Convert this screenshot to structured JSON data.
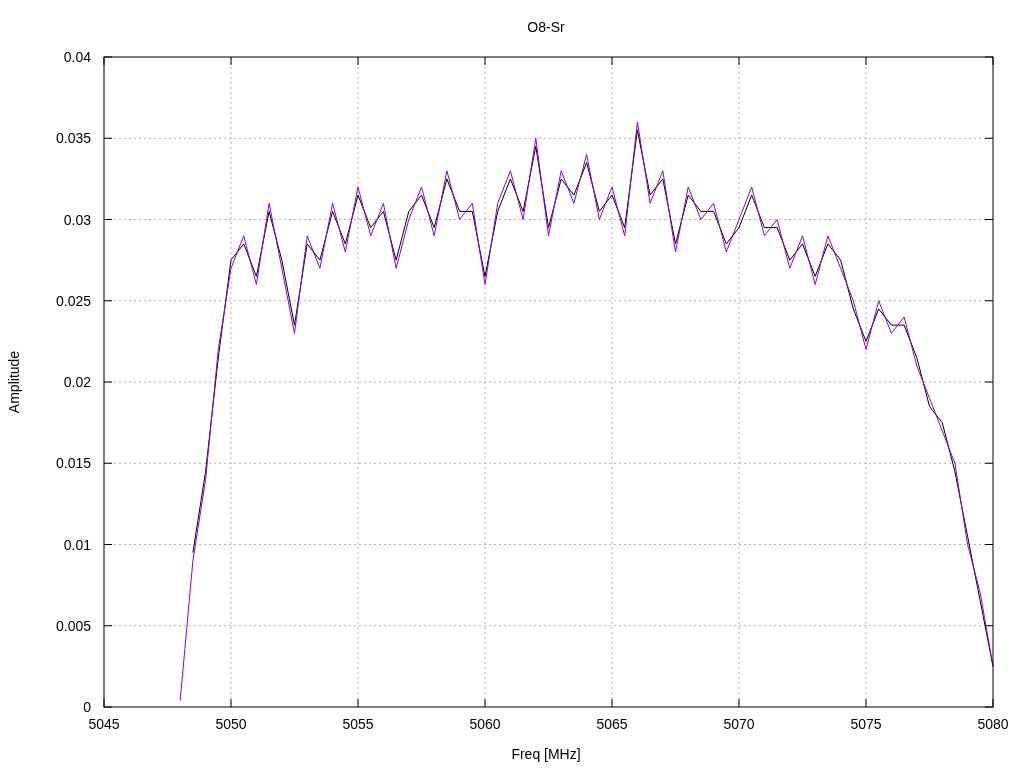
{
  "chart_data": {
    "type": "line",
    "title": "O8-Sr",
    "xlabel": "Freq [MHz]",
    "ylabel": "Amplitude",
    "grid": true,
    "xlim": [
      5045,
      5080
    ],
    "ylim": [
      0,
      0.04
    ],
    "xticks": [
      5045,
      5050,
      5055,
      5060,
      5065,
      5070,
      5075,
      5080
    ],
    "yticks": [
      {
        "value": 0,
        "label": "0"
      },
      {
        "value": 0.005,
        "label": "0.005"
      },
      {
        "value": 0.01,
        "label": "0.01"
      },
      {
        "value": 0.015,
        "label": "0.015"
      },
      {
        "value": 0.02,
        "label": "0.02"
      },
      {
        "value": 0.025,
        "label": "0.025"
      },
      {
        "value": 0.03,
        "label": "0.03"
      },
      {
        "value": 0.035,
        "label": "0.035"
      },
      {
        "value": 0.04,
        "label": "0.04"
      }
    ],
    "x": [
      5048,
      5048.5,
      5049,
      5049.5,
      5050,
      5050.5,
      5051,
      5051.5,
      5052,
      5052.5,
      5053,
      5053.5,
      5054,
      5054.5,
      5055,
      5055.5,
      5056,
      5056.5,
      5057,
      5057.5,
      5058,
      5058.5,
      5059,
      5059.5,
      5060,
      5060.5,
      5061,
      5061.5,
      5062,
      5062.5,
      5063,
      5063.5,
      5064,
      5064.5,
      5065,
      5065.5,
      5066,
      5066.5,
      5067,
      5067.5,
      5068,
      5068.5,
      5069,
      5069.5,
      5070,
      5070.5,
      5071,
      5071.5,
      5072,
      5072.5,
      5073,
      5073.5,
      5074,
      5074.5,
      5075,
      5075.5,
      5076,
      5076.5,
      5077,
      5077.5,
      5078,
      5078.5,
      5079,
      5079.5,
      5080
    ],
    "series": [
      {
        "color": "#000000",
        "values": [
          null,
          0.0095,
          0.0145,
          0.0215,
          0.0275,
          0.0285,
          0.0265,
          0.0305,
          0.0275,
          0.0235,
          0.0285,
          0.0275,
          0.0305,
          0.0285,
          0.0315,
          0.0295,
          0.0305,
          0.0275,
          0.0305,
          0.0315,
          0.0295,
          0.0325,
          0.0305,
          0.0305,
          0.0265,
          0.0305,
          0.0325,
          0.0305,
          0.0345,
          0.0295,
          0.0325,
          0.0315,
          0.0335,
          0.0305,
          0.0315,
          0.0295,
          0.0355,
          0.0315,
          0.0325,
          0.0285,
          0.0315,
          0.0305,
          0.0305,
          0.0285,
          0.0295,
          0.0315,
          0.0295,
          0.0295,
          0.0275,
          0.0285,
          0.0265,
          0.0285,
          0.0275,
          0.0245,
          0.0225,
          0.0245,
          0.0235,
          0.0235,
          0.0215,
          0.0185,
          0.0175,
          0.0145,
          0.0105,
          0.0065,
          0.0025
        ]
      },
      {
        "color": "#9400d3",
        "values": [
          0.0004,
          0.009,
          0.014,
          0.022,
          0.027,
          0.029,
          0.026,
          0.031,
          0.027,
          0.023,
          0.029,
          0.027,
          0.031,
          0.028,
          0.032,
          0.029,
          0.031,
          0.027,
          0.03,
          0.032,
          0.029,
          0.033,
          0.03,
          0.031,
          0.026,
          0.031,
          0.033,
          0.03,
          0.035,
          0.029,
          0.033,
          0.031,
          0.034,
          0.03,
          0.032,
          0.029,
          0.036,
          0.031,
          0.033,
          0.028,
          0.032,
          0.03,
          0.031,
          0.028,
          0.03,
          0.032,
          0.029,
          0.03,
          0.027,
          0.029,
          0.026,
          0.029,
          0.027,
          0.025,
          0.022,
          0.025,
          0.023,
          0.024,
          0.021,
          0.019,
          0.017,
          0.015,
          0.01,
          0.007,
          0.0025
        ]
      }
    ]
  }
}
